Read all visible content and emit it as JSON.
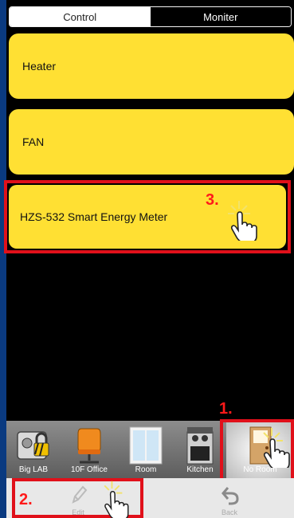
{
  "tabs": [
    {
      "label": "Control",
      "active": true
    },
    {
      "label": "Moniter",
      "active": false
    }
  ],
  "devices": [
    {
      "name": "Heater"
    },
    {
      "name": "FAN"
    },
    {
      "name": "HZS-532 Smart Energy Meter"
    }
  ],
  "annotations": {
    "step1": "1.",
    "step2": "2.",
    "step3": "3."
  },
  "rooms": [
    {
      "label": "Big LAB",
      "icon": "safe-lock-icon"
    },
    {
      "label": "10F Office",
      "icon": "office-chair-icon"
    },
    {
      "label": "Room",
      "icon": "window-icon"
    },
    {
      "label": "Kitchen",
      "icon": "stove-icon"
    },
    {
      "label": "No Room",
      "icon": "door-icon",
      "selected": true
    }
  ],
  "toolbar": {
    "edit_label": "Edit",
    "back_label": "Back"
  },
  "colors": {
    "card": "#ffe033",
    "highlight": "#e0101a",
    "background": "#0a3a80"
  }
}
